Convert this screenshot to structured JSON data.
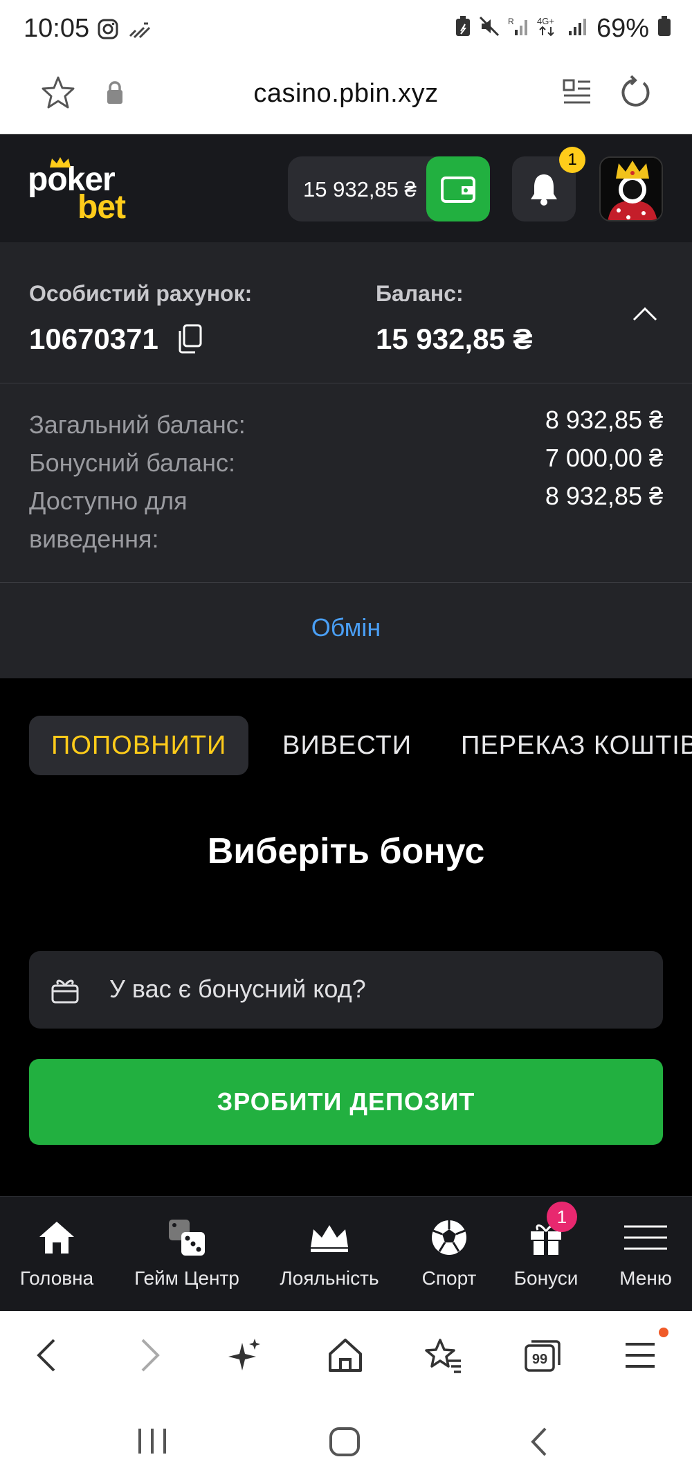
{
  "status_bar": {
    "time": "10:05",
    "battery": "69%",
    "icons": [
      "instagram-icon",
      "signal-wave-icon",
      "battery-saver-icon",
      "mute-icon",
      "roaming-signal-icon",
      "4g-icon",
      "signal-icon",
      "battery-icon"
    ]
  },
  "browser": {
    "url": "casino.pbin.xyz",
    "icons": [
      "star-icon",
      "lock-icon",
      "reader-icon",
      "reload-icon"
    ]
  },
  "header": {
    "logo_top": "poker",
    "logo_bottom": "bet",
    "balance": "15 932,85 ₴",
    "notifications_count": "1",
    "colors": {
      "accent_yellow": "#ffcc1a",
      "accent_green": "#22b040"
    }
  },
  "account": {
    "account_label": "Особистий рахунок:",
    "account_number": "10670371",
    "balance_label": "Баланс:",
    "balance_value": "15 932,85 ₴"
  },
  "details": {
    "rows": [
      {
        "label": "Загальний баланс:",
        "value": "8 932,85 ₴"
      },
      {
        "label": "Бонусний баланс:",
        "value": "7 000,00 ₴"
      },
      {
        "label": "Доступно для виведення:",
        "value": "8 932,85 ₴"
      }
    ]
  },
  "exchange_link": "Обмін",
  "tabs": [
    {
      "label": "ПОПОВНИТИ",
      "active": true
    },
    {
      "label": "ВИВЕСТИ",
      "active": false
    },
    {
      "label": "ПЕРЕКАЗ КОШТІВ",
      "active": false
    }
  ],
  "bonus": {
    "title": "Виберіть бонус",
    "code_placeholder": "У вас є бонусний код?"
  },
  "deposit_button": "ЗРОБИТИ ДЕПОЗИТ",
  "site_nav": {
    "items": [
      {
        "label": "Головна",
        "icon": "home-icon"
      },
      {
        "label": "Гейм Центр",
        "icon": "dice-icon"
      },
      {
        "label": "Лояльність",
        "icon": "crown-icon"
      },
      {
        "label": "Спорт",
        "icon": "soccer-ball-icon"
      },
      {
        "label": "Бонуси",
        "icon": "gift-icon"
      },
      {
        "label": "Меню",
        "icon": "hamburger-icon"
      }
    ],
    "bonus_badge": "1"
  },
  "browser_bottom": {
    "icons": [
      "back-icon",
      "forward-icon",
      "sparkle-icon",
      "home-icon",
      "bookmarks-icon",
      "tabs-icon",
      "menu-icon"
    ],
    "tabs_count": "99"
  },
  "android_nav": {
    "icons": [
      "recents-icon",
      "home-icon",
      "back-icon"
    ]
  }
}
